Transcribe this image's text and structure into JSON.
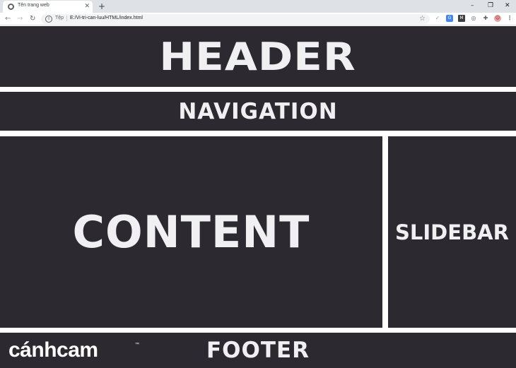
{
  "browser": {
    "tab_title": "Tên trang web",
    "tab_close": "✕",
    "new_tab": "+",
    "window_min": "–",
    "window_max": "❐",
    "window_close": "✕",
    "nav_back": "←",
    "nav_forward": "→",
    "nav_reload": "↻",
    "info": "i",
    "url_scheme": "Tệp",
    "url_separator": "|",
    "url": "E:/Vi-tri-can-luu/HTML/index.html",
    "star": "☆",
    "ext_check": "✓",
    "ext_translate": "G",
    "ext_mail": "M",
    "ext_camera": "◎",
    "ext_puzzle": "✚",
    "ext_avatar": "☺",
    "ext_menu": "⋮"
  },
  "page": {
    "header": "HEADER",
    "navigation": "NAVIGATION",
    "content": "CONTENT",
    "slidebar": "SLIDEBAR",
    "footer": "FOOTER",
    "logo": "cánhcam",
    "logo_tm": "™"
  },
  "colors": {
    "block_background": "#2c2a30",
    "block_text": "#f0f0f2",
    "page_background": "#ffffff"
  }
}
